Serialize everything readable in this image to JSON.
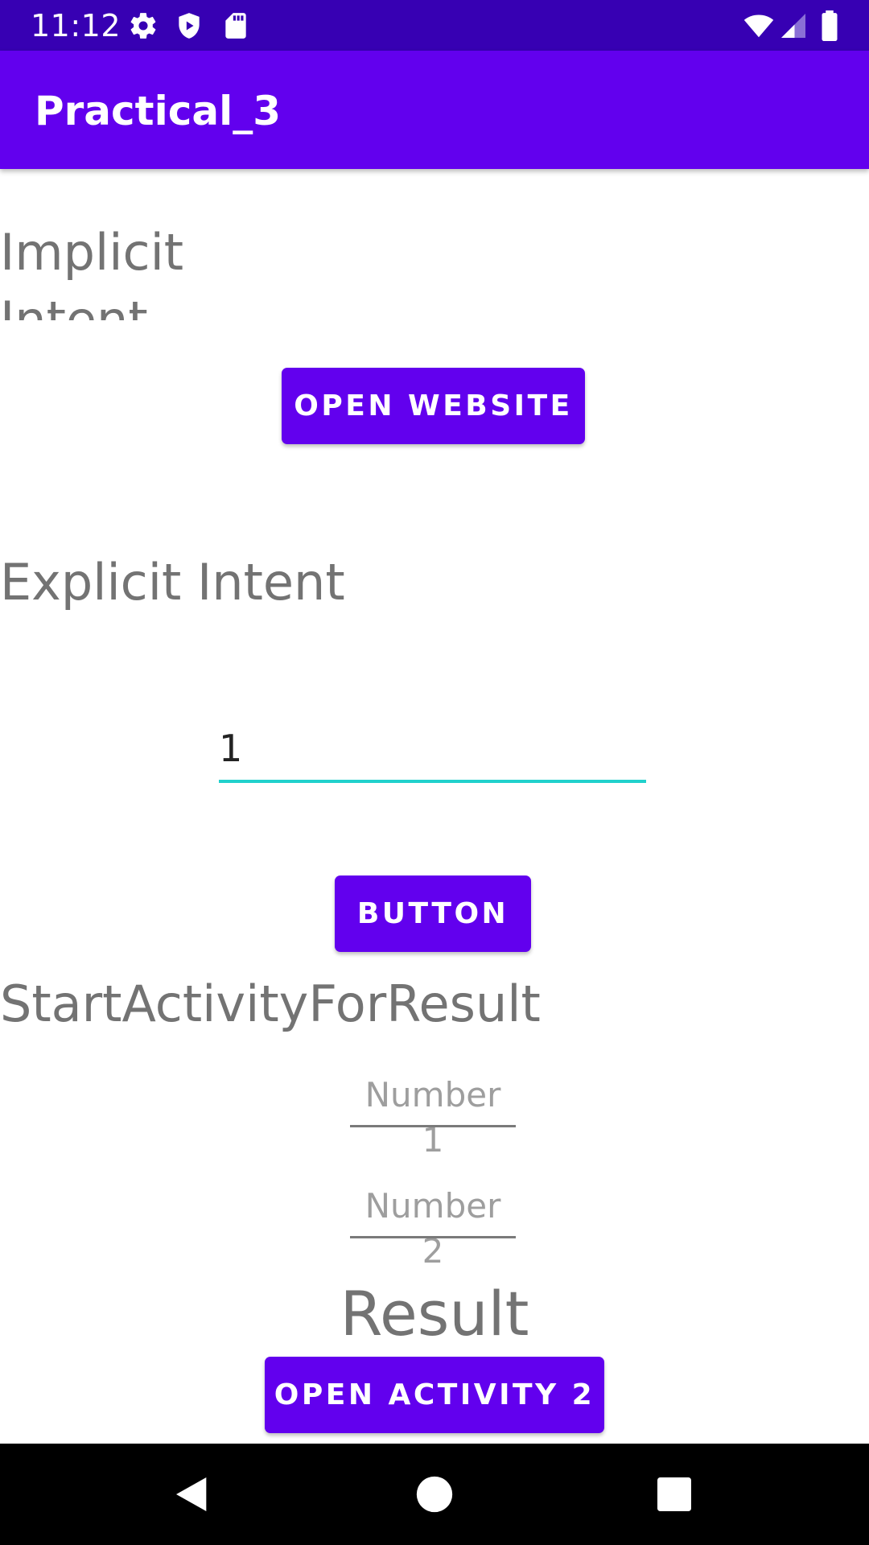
{
  "status_bar": {
    "time": "11:12",
    "background": "#3700b3",
    "left_icons": [
      "gear-icon",
      "shield-icon",
      "sd-card-icon"
    ],
    "right_icons": [
      "wifi-icon",
      "cell-signal-icon",
      "battery-icon"
    ]
  },
  "app_bar": {
    "title": "Practical_3",
    "background": "#6200ee"
  },
  "implicit_section": {
    "label_line1": "Implicit",
    "label_line2": "Intent",
    "button_label": "OPEN WEBSITE"
  },
  "explicit_section": {
    "label": "Explicit Intent",
    "input_value": "1",
    "input_underline_color": "#20d1cc",
    "button_label": "BUTTON"
  },
  "result_section": {
    "label": "StartActivityForResult",
    "number1_placeholder": "Number 1",
    "number2_placeholder": "Number 2",
    "result_text": "Result",
    "button_label": "OPEN ACTIVITY 2"
  },
  "nav_bar": {
    "back": "back-icon",
    "home": "home-icon",
    "recents": "recents-icon"
  }
}
